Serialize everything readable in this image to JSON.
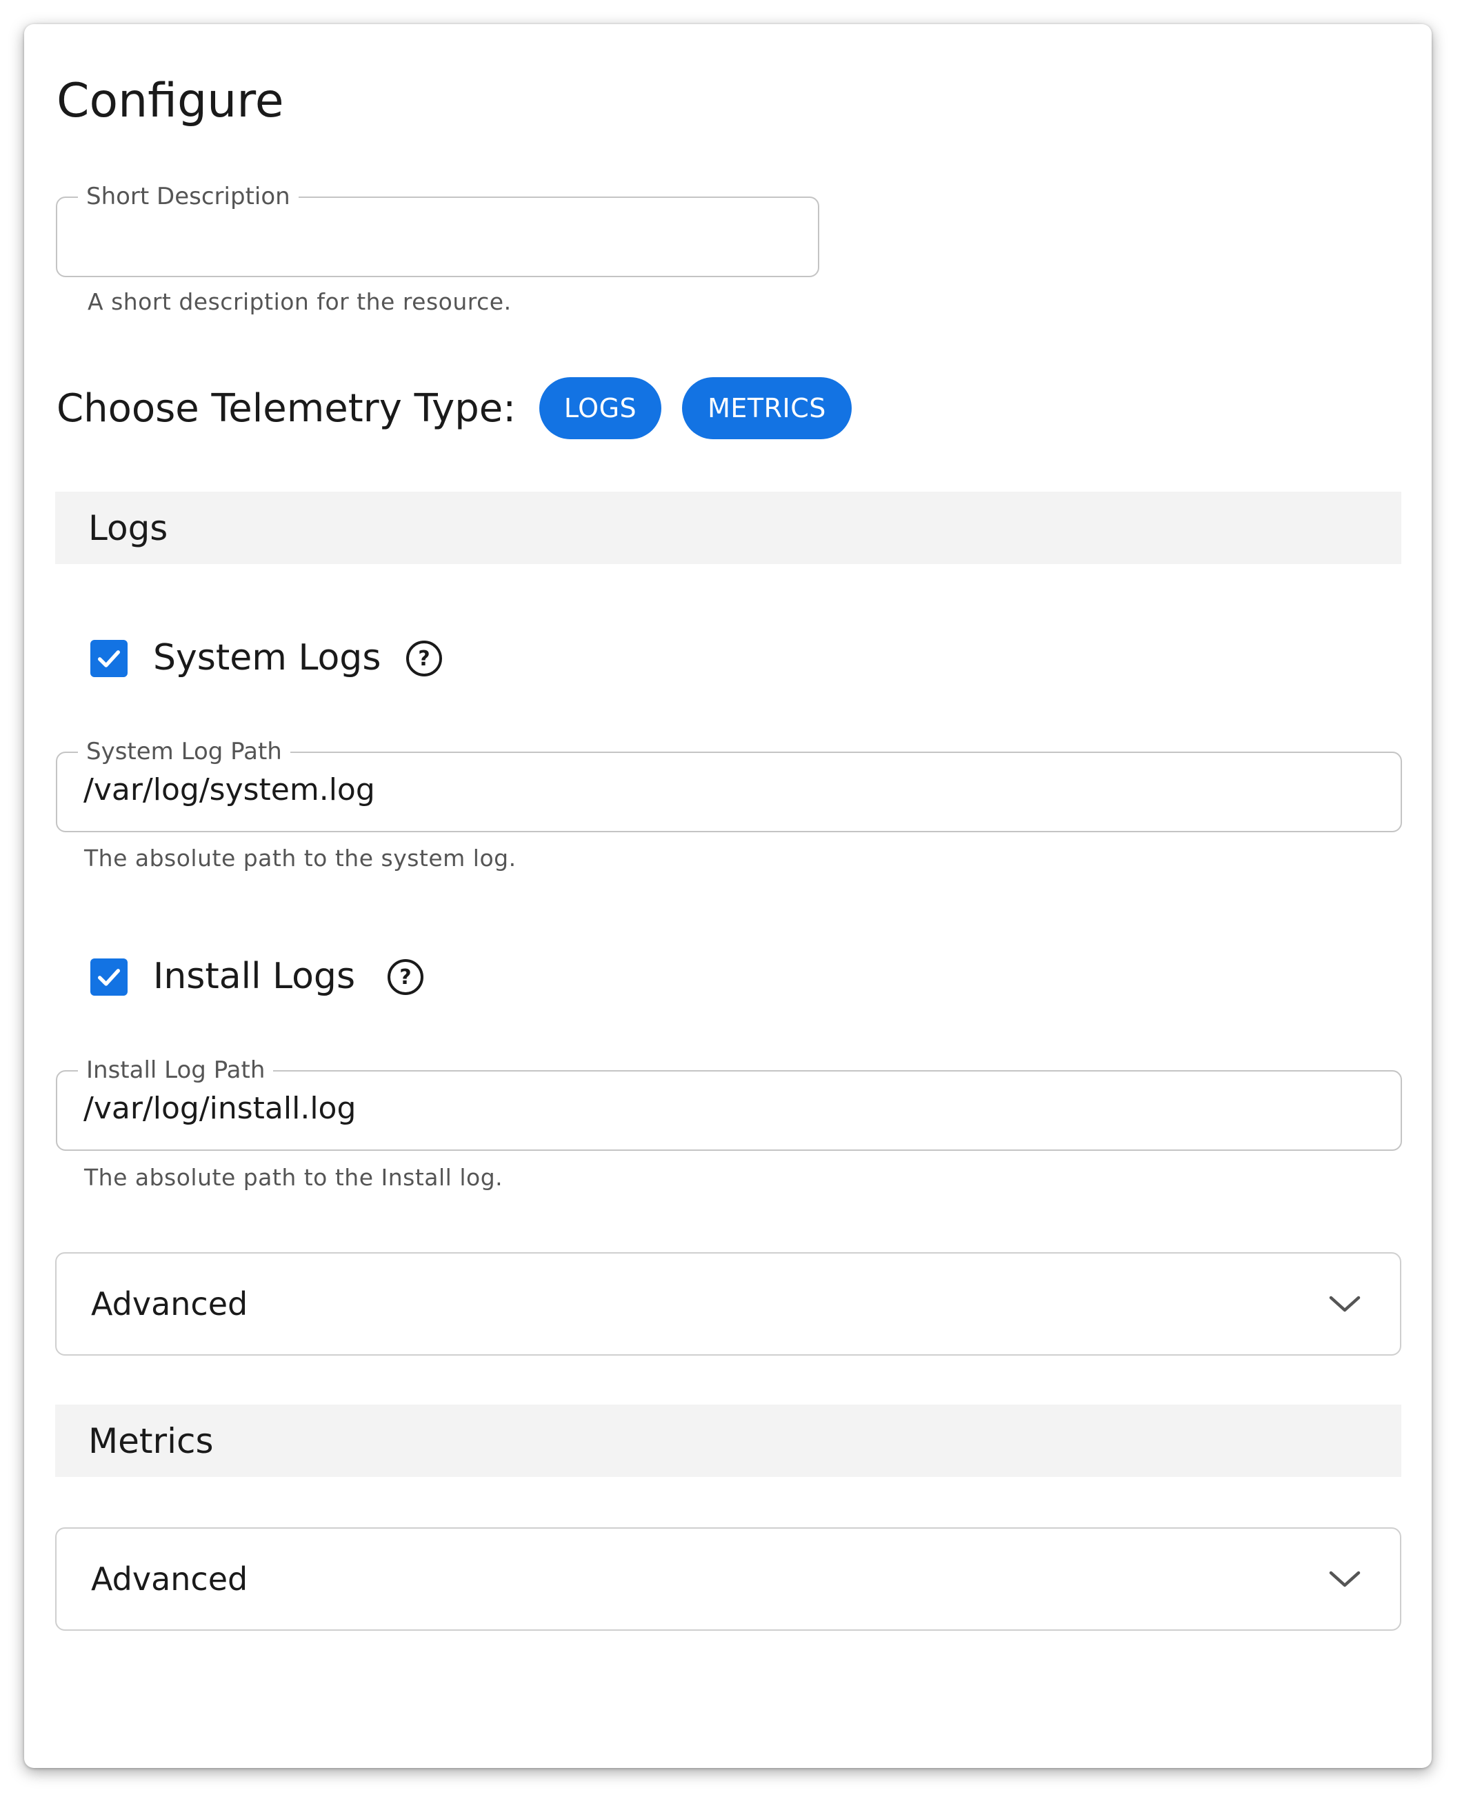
{
  "page": {
    "title": "Configure"
  },
  "short_description": {
    "label": "Short Description",
    "value": "",
    "helper": "A short description for the resource."
  },
  "telemetry": {
    "label": "Choose Telemetry Type:",
    "chips": [
      {
        "label": "LOGS"
      },
      {
        "label": "METRICS"
      }
    ],
    "chip_color": "#1373e3"
  },
  "logs_section": {
    "title": "Logs",
    "system_logs": {
      "label": "System Logs",
      "checked": true,
      "help_icon": "question-circle-icon",
      "path_label": "System Log Path",
      "path_value": "/var/log/system.log",
      "helper": "The absolute path to the system log."
    },
    "install_logs": {
      "label": "Install Logs",
      "checked": true,
      "help_icon": "question-circle-icon",
      "path_label": "Install Log Path",
      "path_value": "/var/log/install.log",
      "helper": "The absolute path to the Install log."
    },
    "advanced": {
      "title": "Advanced",
      "icon": "chevron-down-icon"
    }
  },
  "metrics_section": {
    "title": "Metrics",
    "advanced": {
      "title": "Advanced",
      "icon": "chevron-down-icon"
    }
  }
}
